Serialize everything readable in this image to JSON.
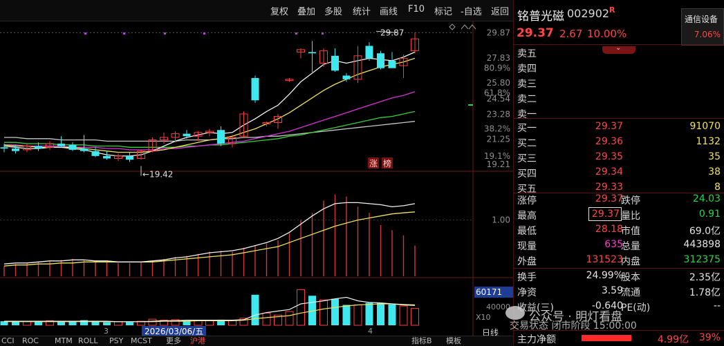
{
  "toolbar": {
    "items": [
      "复权",
      "叠加",
      "多股",
      "统计",
      "画线",
      "F10",
      "标记",
      "-自选",
      "返回"
    ]
  },
  "stock": {
    "name": "铭普光磁",
    "code": "002902",
    "r_badge": "R",
    "price": "29.37",
    "change": "2.67",
    "change_pct": "10.00%",
    "sector_name": "通信设备",
    "sector_pct": "7.06%"
  },
  "order_book": {
    "sell": [
      {
        "label": "卖五",
        "price": "",
        "vol": ""
      },
      {
        "label": "卖四",
        "price": "",
        "vol": ""
      },
      {
        "label": "卖三",
        "price": "",
        "vol": ""
      },
      {
        "label": "卖二",
        "price": "",
        "vol": ""
      },
      {
        "label": "卖一",
        "price": "",
        "vol": ""
      }
    ],
    "buy": [
      {
        "label": "买一",
        "price": "29.37",
        "vol": "91070"
      },
      {
        "label": "买二",
        "price": "29.36",
        "vol": "1132"
      },
      {
        "label": "买三",
        "price": "29.35",
        "vol": "35"
      },
      {
        "label": "买四",
        "price": "29.34",
        "vol": "38"
      },
      {
        "label": "买五",
        "price": "29.33",
        "vol": "8"
      }
    ]
  },
  "stats": {
    "limit_up_label": "涨停",
    "limit_up": "29.37",
    "limit_down_label": "跌停",
    "limit_down": "24.03",
    "high_label": "最高",
    "high": "29.37",
    "vol_ratio_label": "量比",
    "vol_ratio": "0.91",
    "low_label": "最低",
    "low": "28.18",
    "mcap_label": "市值",
    "mcap": "69.0亿",
    "cur_vol_label": "现量",
    "cur_vol": "635",
    "total_vol_label": "总量",
    "total_vol": "443898",
    "outer_label": "外盘",
    "outer": "131523",
    "inner_label": "内盘",
    "inner": "312375",
    "turnover_label": "换手",
    "turnover": "24.99%",
    "shares_label": "股本",
    "shares": "2.35亿",
    "nav_label": "净资",
    "nav": "3.59",
    "float_label": "流通",
    "float": "1.78亿",
    "eps_label": "收益(三)",
    "eps": "-0.640",
    "pe_label": "PE(动)",
    "pe": "--",
    "mainflow_label": "主力净额",
    "mainflow": "4.99亿",
    "mainflow_pct": "39%"
  },
  "watermark": {
    "line1": "公众号 · 明灯看盘",
    "line2": "交易状态 闭市阶段 15:00:00"
  },
  "chart_labels": {
    "price_high": "29.87",
    "price_low": "19.42",
    "limit_tag_1": "涨",
    "limit_tag_2": "榜",
    "axis_price": [
      "29.87",
      "27.83",
      "25.80",
      "24.54",
      "23.28",
      "21.25",
      "19.21"
    ],
    "axis_pct": [
      "80.9%",
      "61.8%",
      "38.2%",
      "19.1%"
    ],
    "axis_mid": "1.00",
    "vol_box": "60171",
    "vol_tick": "40000",
    "vol_unit": "X10",
    "date_box": "2026/03/06/五",
    "x_tick_1": "3",
    "x_tick_2": "4"
  },
  "bottombar": {
    "items": [
      "CCI",
      "ROC",
      "MTM",
      "ROLL",
      "PSY",
      "MCST",
      "更多",
      "沪港"
    ],
    "right": [
      "指标B",
      "模板"
    ],
    "day_label": "日线"
  },
  "chart_data": {
    "type": "candlestick",
    "up_color": "#ff3c3c",
    "down_color": "#3fe8ee",
    "ma_colors": [
      "#f2f2f2",
      "#f3e25a",
      "#d931d9",
      "#35d23a",
      "#c9c9c9"
    ],
    "y_range": [
      19.0,
      30.5
    ],
    "candles": [
      {
        "o": 20.6,
        "h": 20.9,
        "l": 20.2,
        "c": 20.5
      },
      {
        "o": 20.5,
        "h": 20.8,
        "l": 20.1,
        "c": 20.3
      },
      {
        "o": 20.4,
        "h": 20.9,
        "l": 20.2,
        "c": 20.7
      },
      {
        "o": 20.7,
        "h": 21.0,
        "l": 20.3,
        "c": 20.5
      },
      {
        "o": 20.6,
        "h": 21.1,
        "l": 20.4,
        "c": 20.9
      },
      {
        "o": 20.9,
        "h": 21.5,
        "l": 20.6,
        "c": 20.7
      },
      {
        "o": 20.8,
        "h": 21.0,
        "l": 20.3,
        "c": 20.4
      },
      {
        "o": 20.5,
        "h": 21.6,
        "l": 20.2,
        "c": 20.3
      },
      {
        "o": 20.3,
        "h": 20.6,
        "l": 19.8,
        "c": 19.9
      },
      {
        "o": 19.9,
        "h": 20.3,
        "l": 19.6,
        "c": 19.7
      },
      {
        "o": 19.7,
        "h": 20.1,
        "l": 19.5,
        "c": 19.9
      },
      {
        "o": 19.9,
        "h": 20.2,
        "l": 19.42,
        "c": 19.6
      },
      {
        "o": 19.7,
        "h": 20.4,
        "l": 19.6,
        "c": 20.3
      },
      {
        "o": 20.3,
        "h": 21.4,
        "l": 20.2,
        "c": 21.2
      },
      {
        "o": 21.2,
        "h": 21.8,
        "l": 20.9,
        "c": 21.4
      },
      {
        "o": 21.4,
        "h": 21.9,
        "l": 21.0,
        "c": 21.7
      },
      {
        "o": 21.7,
        "h": 22.0,
        "l": 21.3,
        "c": 21.5
      },
      {
        "o": 21.5,
        "h": 21.9,
        "l": 21.1,
        "c": 21.8
      },
      {
        "o": 21.8,
        "h": 22.1,
        "l": 21.5,
        "c": 21.9
      },
      {
        "o": 22.0,
        "h": 22.3,
        "l": 20.7,
        "c": 20.9
      },
      {
        "o": 20.9,
        "h": 21.6,
        "l": 20.6,
        "c": 21.4
      },
      {
        "o": 21.5,
        "h": 23.5,
        "l": 21.4,
        "c": 23.3
      },
      {
        "o": 26.2,
        "h": 26.4,
        "l": 24.2,
        "c": 24.4
      },
      {
        "o": 22.5,
        "h": 22.7,
        "l": 22.3,
        "c": 22.6
      },
      {
        "o": 22.6,
        "h": 23.3,
        "l": 22.1,
        "c": 23.1
      },
      {
        "o": 26.0,
        "h": 26.2,
        "l": 25.9,
        "c": 26.1
      },
      {
        "o": 28.3,
        "h": 28.6,
        "l": 27.8,
        "c": 28.5
      },
      {
        "o": 28.3,
        "h": 29.2,
        "l": 26.7,
        "c": 28.2
      },
      {
        "o": 27.4,
        "h": 28.6,
        "l": 27.1,
        "c": 28.4
      },
      {
        "o": 28.0,
        "h": 28.6,
        "l": 26.7,
        "c": 26.8
      },
      {
        "o": 26.4,
        "h": 26.6,
        "l": 25.9,
        "c": 26.1
      },
      {
        "o": 26.1,
        "h": 28.8,
        "l": 25.8,
        "c": 28.0
      },
      {
        "o": 28.8,
        "h": 29.1,
        "l": 27.6,
        "c": 27.8
      },
      {
        "o": 28.2,
        "h": 28.4,
        "l": 26.9,
        "c": 27.0
      },
      {
        "o": 27.6,
        "h": 28.3,
        "l": 27.3,
        "c": 27.0
      },
      {
        "o": 27.2,
        "h": 28.1,
        "l": 26.2,
        "c": 27.8
      },
      {
        "o": 28.4,
        "h": 29.87,
        "l": 28.2,
        "c": 29.37
      }
    ],
    "ma5": [
      20.7,
      20.6,
      20.5,
      20.5,
      20.6,
      20.6,
      20.5,
      20.4,
      20.2,
      20.0,
      19.9,
      19.9,
      20.0,
      20.3,
      20.7,
      21.1,
      21.4,
      21.6,
      21.8,
      21.7,
      21.8,
      22.4,
      22.9,
      23.5,
      24.0,
      24.9,
      25.9,
      26.6,
      27.3,
      27.6,
      27.4,
      27.6,
      27.8,
      27.7,
      27.6,
      27.9,
      28.3
    ],
    "ma10": [
      20.8,
      20.7,
      20.7,
      20.6,
      20.6,
      20.6,
      20.6,
      20.5,
      20.4,
      20.3,
      20.2,
      20.2,
      20.2,
      20.3,
      20.4,
      20.6,
      20.8,
      21.0,
      21.2,
      21.3,
      21.5,
      21.8,
      22.1,
      22.5,
      22.9,
      23.4,
      24.0,
      24.6,
      25.2,
      25.7,
      26.1,
      26.5,
      26.8,
      27.1,
      27.3,
      27.5,
      27.8
    ],
    "ma20": [
      20.8,
      20.8,
      20.7,
      20.7,
      20.7,
      20.7,
      20.6,
      20.6,
      20.6,
      20.5,
      20.5,
      20.4,
      20.4,
      20.4,
      20.5,
      20.5,
      20.6,
      20.7,
      20.8,
      20.9,
      21.0,
      21.1,
      21.3,
      21.5,
      21.7,
      21.9,
      22.2,
      22.5,
      22.8,
      23.1,
      23.4,
      23.7,
      24.0,
      24.3,
      24.6,
      24.8,
      25.1
    ],
    "ma30": [
      21.0,
      21.0,
      20.9,
      20.9,
      20.9,
      20.8,
      20.8,
      20.8,
      20.7,
      20.7,
      20.7,
      20.6,
      20.6,
      20.6,
      20.6,
      20.6,
      20.7,
      20.7,
      20.8,
      20.8,
      20.9,
      21.0,
      21.1,
      21.2,
      21.3,
      21.5,
      21.6,
      21.8,
      22.0,
      22.2,
      22.4,
      22.6,
      22.8,
      23.0,
      23.1,
      23.3,
      23.5
    ],
    "ma60": [
      21.4,
      21.4,
      21.3,
      21.3,
      21.3,
      21.2,
      21.2,
      21.2,
      21.2,
      21.1,
      21.1,
      21.1,
      21.1,
      21.1,
      21.1,
      21.1,
      21.2,
      21.2,
      21.2,
      21.3,
      21.3,
      21.4,
      21.4,
      21.5,
      21.5,
      21.6,
      21.7,
      21.8,
      21.9,
      22.0,
      22.1,
      22.2,
      22.3,
      22.4,
      22.5,
      22.6,
      22.7
    ],
    "indicator": {
      "bars": [
        0.1,
        0.12,
        0.13,
        0.14,
        0.15,
        0.16,
        0.17,
        0.16,
        0.15,
        0.14,
        0.13,
        0.13,
        0.14,
        0.15,
        0.17,
        0.19,
        0.2,
        0.22,
        0.24,
        0.25,
        0.24,
        0.28,
        0.3,
        0.32,
        0.35,
        0.42,
        0.55,
        0.62,
        0.74,
        0.8,
        0.78,
        0.68,
        0.62,
        0.5,
        0.45,
        0.4,
        0.3
      ],
      "line1": [
        0.12,
        0.13,
        0.13,
        0.14,
        0.15,
        0.15,
        0.16,
        0.16,
        0.15,
        0.15,
        0.14,
        0.14,
        0.14,
        0.15,
        0.16,
        0.18,
        0.19,
        0.21,
        0.23,
        0.24,
        0.25,
        0.27,
        0.3,
        0.33,
        0.37,
        0.43,
        0.51,
        0.59,
        0.66,
        0.71,
        0.72,
        0.72,
        0.71,
        0.7,
        0.68,
        0.69,
        0.71
      ],
      "line2": [
        0.1,
        0.11,
        0.11,
        0.12,
        0.12,
        0.13,
        0.13,
        0.14,
        0.14,
        0.14,
        0.14,
        0.14,
        0.14,
        0.14,
        0.15,
        0.16,
        0.17,
        0.18,
        0.19,
        0.2,
        0.21,
        0.23,
        0.25,
        0.27,
        0.29,
        0.33,
        0.37,
        0.41,
        0.45,
        0.49,
        0.52,
        0.55,
        0.57,
        0.59,
        0.61,
        0.62,
        0.63
      ],
      "mid_level": 1.0
    },
    "volume": {
      "bars": [
        0.08,
        0.07,
        0.08,
        0.07,
        0.09,
        0.08,
        0.07,
        0.1,
        0.07,
        0.06,
        0.07,
        0.06,
        0.08,
        0.12,
        0.1,
        0.11,
        0.09,
        0.1,
        0.09,
        0.11,
        0.1,
        0.14,
        0.6,
        0.24,
        0.2,
        0.27,
        0.7,
        0.58,
        0.5,
        0.52,
        0.4,
        0.4,
        0.44,
        0.44,
        0.41,
        0.38,
        0.33
      ],
      "ma1": [
        0.08,
        0.08,
        0.08,
        0.08,
        0.08,
        0.08,
        0.08,
        0.08,
        0.08,
        0.08,
        0.07,
        0.07,
        0.07,
        0.08,
        0.09,
        0.09,
        0.1,
        0.1,
        0.1,
        0.1,
        0.1,
        0.11,
        0.2,
        0.25,
        0.28,
        0.31,
        0.42,
        0.45,
        0.48,
        0.52,
        0.55,
        0.48,
        0.45,
        0.44,
        0.42,
        0.4,
        0.39
      ],
      "ma2": [
        0.07,
        0.07,
        0.07,
        0.07,
        0.07,
        0.07,
        0.07,
        0.07,
        0.07,
        0.07,
        0.07,
        0.07,
        0.07,
        0.07,
        0.08,
        0.08,
        0.08,
        0.09,
        0.09,
        0.09,
        0.09,
        0.1,
        0.13,
        0.15,
        0.17,
        0.19,
        0.24,
        0.28,
        0.32,
        0.35,
        0.38,
        0.4,
        0.41,
        0.42,
        0.42,
        0.41,
        0.4
      ]
    }
  }
}
